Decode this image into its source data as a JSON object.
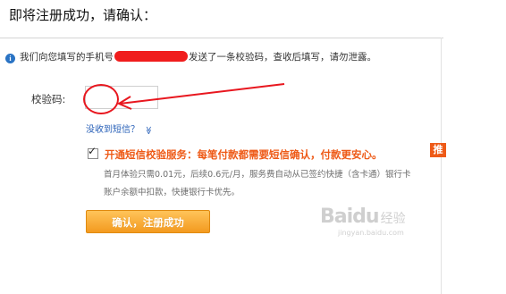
{
  "page": {
    "title": "即将注册成功，请确认："
  },
  "info": {
    "icon": "info-icon",
    "prefix": "我们向您填写的手机号",
    "suffix": "发送了一条校验码，查收后填写，请勿泄露。"
  },
  "form": {
    "code_label": "校验码:",
    "code_value": "",
    "not_received": "没收到短信？",
    "chevron": "≫"
  },
  "sms_service": {
    "checked": true,
    "label": "开通短信校验服务：每笔付款都需要短信确认，付款更安心。",
    "tag": "推",
    "note_line1": "首月体验只需0.01元，后续0.6元/月，服务费自动从已签约快捷（含卡通）银行卡",
    "note_line2": "账户余额中扣款，快捷银行卡优先。"
  },
  "buttons": {
    "confirm": "确认，注册成功"
  },
  "watermark": {
    "logo": "Baidu",
    "word": "经验",
    "url": "jingyan.baidu.com"
  },
  "colors": {
    "accent_orange": "#ee5a17",
    "button_orange": "#f39a1f",
    "link_blue": "#2860b8",
    "annotation_red": "#e8171f"
  }
}
